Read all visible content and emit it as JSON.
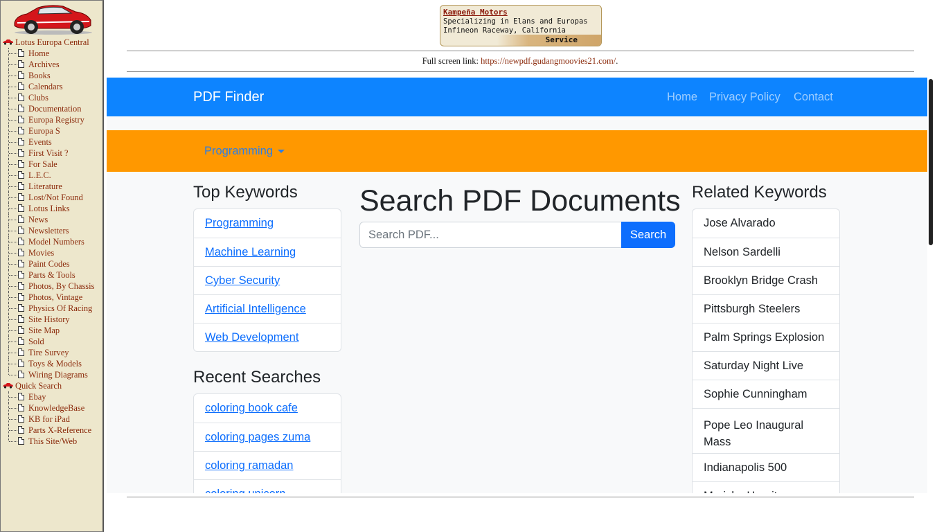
{
  "sidebar": {
    "items": [
      {
        "label": "Lotus Europa Central",
        "kind": "root",
        "icon": "red-car-icon"
      },
      {
        "label": "Home",
        "kind": "leaf"
      },
      {
        "label": "Archives",
        "kind": "leaf"
      },
      {
        "label": "Books",
        "kind": "leaf"
      },
      {
        "label": "Calendars",
        "kind": "leaf"
      },
      {
        "label": "Clubs",
        "kind": "leaf"
      },
      {
        "label": "Documentation",
        "kind": "leaf"
      },
      {
        "label": "Europa Registry",
        "kind": "leaf"
      },
      {
        "label": "Europa S",
        "kind": "leaf"
      },
      {
        "label": "Events",
        "kind": "leaf"
      },
      {
        "label": "First Visit ?",
        "kind": "leaf"
      },
      {
        "label": "For Sale",
        "kind": "leaf"
      },
      {
        "label": "L.E.C.",
        "kind": "leaf"
      },
      {
        "label": "Literature",
        "kind": "leaf"
      },
      {
        "label": "Lost/Not Found",
        "kind": "leaf"
      },
      {
        "label": "Lotus Links",
        "kind": "leaf"
      },
      {
        "label": "News",
        "kind": "leaf"
      },
      {
        "label": "Newsletters",
        "kind": "leaf"
      },
      {
        "label": "Model Numbers",
        "kind": "leaf"
      },
      {
        "label": "Movies",
        "kind": "leaf"
      },
      {
        "label": "Paint Codes",
        "kind": "leaf"
      },
      {
        "label": "Parts & Tools",
        "kind": "leaf"
      },
      {
        "label": "Photos, By Chassis",
        "kind": "leaf"
      },
      {
        "label": "Photos, Vintage",
        "kind": "leaf"
      },
      {
        "label": "Physics Of Racing",
        "kind": "leaf"
      },
      {
        "label": "Site History",
        "kind": "leaf"
      },
      {
        "label": "Site Map",
        "kind": "leaf"
      },
      {
        "label": "Sold",
        "kind": "leaf"
      },
      {
        "label": "Tire Survey",
        "kind": "leaf"
      },
      {
        "label": "Toys & Models",
        "kind": "leaf"
      },
      {
        "label": "Wiring Diagrams",
        "kind": "leaf",
        "last": true
      },
      {
        "label": "Quick Search",
        "kind": "root",
        "icon": "red-car-icon"
      },
      {
        "label": "Ebay",
        "kind": "leaf"
      },
      {
        "label": "KnowledgeBase",
        "kind": "leaf"
      },
      {
        "label": "KB for iPad",
        "kind": "leaf"
      },
      {
        "label": "Parts X-Reference",
        "kind": "leaf"
      },
      {
        "label": "This Site/Web",
        "kind": "leaf",
        "last": true
      }
    ]
  },
  "ad": {
    "title": "Kampeña Motors",
    "line1": "Specializing in Elans and Europas",
    "line2": "Infineon Raceway, California",
    "service": "Service"
  },
  "fullscreen": {
    "prefix": "Full screen link: ",
    "url": "https://newpdf.gudangmoovies21.com/",
    "suffix": "."
  },
  "navbar": {
    "brand": "PDF Finder",
    "links": [
      "Home",
      "Privacy Policy",
      "Contact"
    ]
  },
  "category": {
    "selected": "Programming"
  },
  "top_keywords": {
    "heading": "Top Keywords",
    "items": [
      "Programming",
      "Machine Learning",
      "Cyber Security",
      "Artificial Intelligence",
      "Web Development"
    ]
  },
  "recent_searches": {
    "heading": "Recent Searches",
    "items": [
      "coloring book cafe",
      "coloring pages zuma",
      "coloring ramadan",
      "coloring unicorn"
    ]
  },
  "search": {
    "title": "Search PDF Documents",
    "placeholder": "Search PDF...",
    "button": "Search"
  },
  "related_keywords": {
    "heading": "Related Keywords",
    "items": [
      "Jose Alvarado",
      "Nelson Sardelli",
      "Brooklyn Bridge Crash",
      "Pittsburgh Steelers",
      "Palm Springs Explosion",
      "Saturday Night Live",
      "Sophie Cunningham",
      "Pope Leo Inaugural Mass",
      "Indianapolis 500",
      "Mariska Hargitay"
    ]
  },
  "colors": {
    "navbar": "#0d84ff",
    "category_bar": "#ff9800",
    "link": "#0d6efd",
    "sidebar_bg": "#ede7cc",
    "sidebar_text": "#8b2a0b"
  }
}
